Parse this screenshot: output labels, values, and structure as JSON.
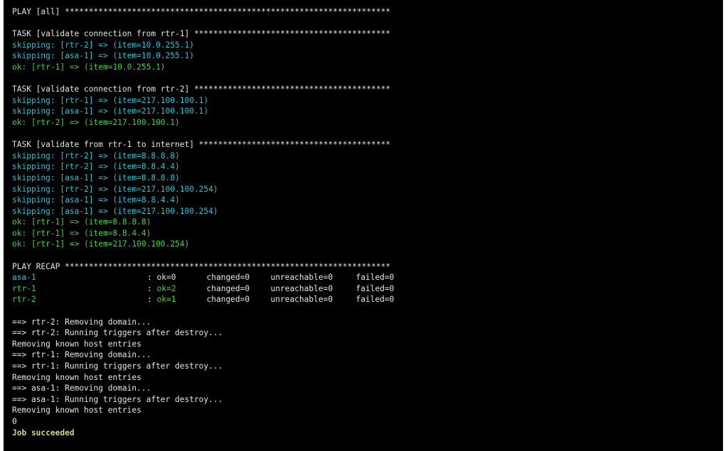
{
  "colors": {
    "background": "#000000",
    "default_text": "#e6e6e6",
    "skipping": "#22c4d6",
    "ok": "#3fd23f",
    "job_status": "#d6d670"
  },
  "terminal": {
    "lines": [
      {
        "text": "PLAY [all] ********************************************************************",
        "color": "white"
      },
      {
        "text": "",
        "color": "white"
      },
      {
        "text": "TASK [validate connection from rtr-1] *****************************************",
        "color": "white"
      },
      {
        "text": "skipping: [rtr-2] => (item=10.0.255.1)",
        "color": "cyan"
      },
      {
        "text": "skipping: [asa-1] => (item=10.0.255.1)",
        "color": "cyan"
      },
      {
        "text": "ok: [rtr-1] => (item=10.0.255.1)",
        "color": "green"
      },
      {
        "text": "",
        "color": "white"
      },
      {
        "text": "TASK [validate connection from rtr-2] *****************************************",
        "color": "white"
      },
      {
        "text": "skipping: [rtr-1] => (item=217.100.100.1)",
        "color": "cyan"
      },
      {
        "text": "skipping: [asa-1] => (item=217.100.100.1)",
        "color": "cyan"
      },
      {
        "text": "ok: [rtr-2] => (item=217.100.100.1)",
        "color": "green"
      },
      {
        "text": "",
        "color": "white"
      },
      {
        "text": "TASK [validate from rtr-1 to internet] ****************************************",
        "color": "white"
      },
      {
        "text": "skipping: [rtr-2] => (item=8.8.8.8)",
        "color": "cyan"
      },
      {
        "text": "skipping: [rtr-2] => (item=8.8.4.4)",
        "color": "cyan"
      },
      {
        "text": "skipping: [asa-1] => (item=8.8.8.8)",
        "color": "cyan"
      },
      {
        "text": "skipping: [rtr-2] => (item=217.100.100.254)",
        "color": "cyan"
      },
      {
        "text": "skipping: [asa-1] => (item=8.8.4.4)",
        "color": "cyan"
      },
      {
        "text": "skipping: [asa-1] => (item=217.100.100.254)",
        "color": "cyan"
      },
      {
        "text": "ok: [rtr-1] => (item=8.8.8.8)",
        "color": "green"
      },
      {
        "text": "ok: [rtr-1] => (item=8.8.4.4)",
        "color": "green"
      },
      {
        "text": "ok: [rtr-1] => (item=217.100.100.254)",
        "color": "green"
      },
      {
        "text": "",
        "color": "white"
      },
      {
        "text": "PLAY RECAP ********************************************************************",
        "color": "white"
      }
    ],
    "recap": [
      {
        "host": "asa-1",
        "host_color": "cyan",
        "ok": "ok=0",
        "ok_color": "white",
        "changed": "changed=0",
        "unreachable": "unreachable=0",
        "failed": "failed=0"
      },
      {
        "host": "rtr-1",
        "host_color": "green",
        "ok": "ok=2",
        "ok_color": "green",
        "changed": "changed=0",
        "unreachable": "unreachable=0",
        "failed": "failed=0"
      },
      {
        "host": "rtr-2",
        "host_color": "green",
        "ok": "ok=1",
        "ok_color": "green",
        "changed": "changed=0",
        "unreachable": "unreachable=0",
        "failed": "failed=0"
      }
    ],
    "recap_separator": ":",
    "tail_lines": [
      {
        "text": "",
        "color": "white"
      },
      {
        "text": "==> rtr-2: Removing domain...",
        "color": "white"
      },
      {
        "text": "==> rtr-2: Running triggers after destroy...",
        "color": "white"
      },
      {
        "text": "Removing known host entries",
        "color": "white"
      },
      {
        "text": "==> rtr-1: Removing domain...",
        "color": "white"
      },
      {
        "text": "==> rtr-1: Running triggers after destroy...",
        "color": "white"
      },
      {
        "text": "Removing known host entries",
        "color": "white"
      },
      {
        "text": "==> asa-1: Removing domain...",
        "color": "white"
      },
      {
        "text": "==> asa-1: Running triggers after destroy...",
        "color": "white"
      },
      {
        "text": "Removing known host entries",
        "color": "white"
      },
      {
        "text": "0",
        "color": "white"
      },
      {
        "text": "Job succeeded",
        "color": "yellow"
      }
    ]
  }
}
